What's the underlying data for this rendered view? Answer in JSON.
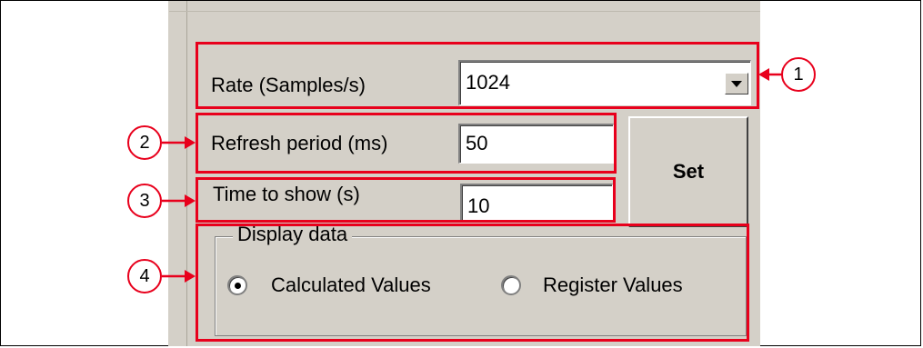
{
  "rate": {
    "label": "Rate (Samples/s)",
    "value": "1024"
  },
  "refresh": {
    "label": "Refresh period (ms)",
    "value": "50"
  },
  "time_to_show": {
    "label": "Time to show (s)",
    "value": "10"
  },
  "set_button": {
    "label": "Set"
  },
  "display_data": {
    "title": "Display data",
    "options": [
      {
        "label": "Calculated Values",
        "selected": true
      },
      {
        "label": "Register Values",
        "selected": false
      }
    ]
  },
  "callouts": [
    "1",
    "2",
    "3",
    "4"
  ],
  "colors": {
    "panel": "#d4d0c8",
    "highlight": "#e8001c"
  },
  "icons": {
    "dropdown": "chevron-down-icon"
  }
}
